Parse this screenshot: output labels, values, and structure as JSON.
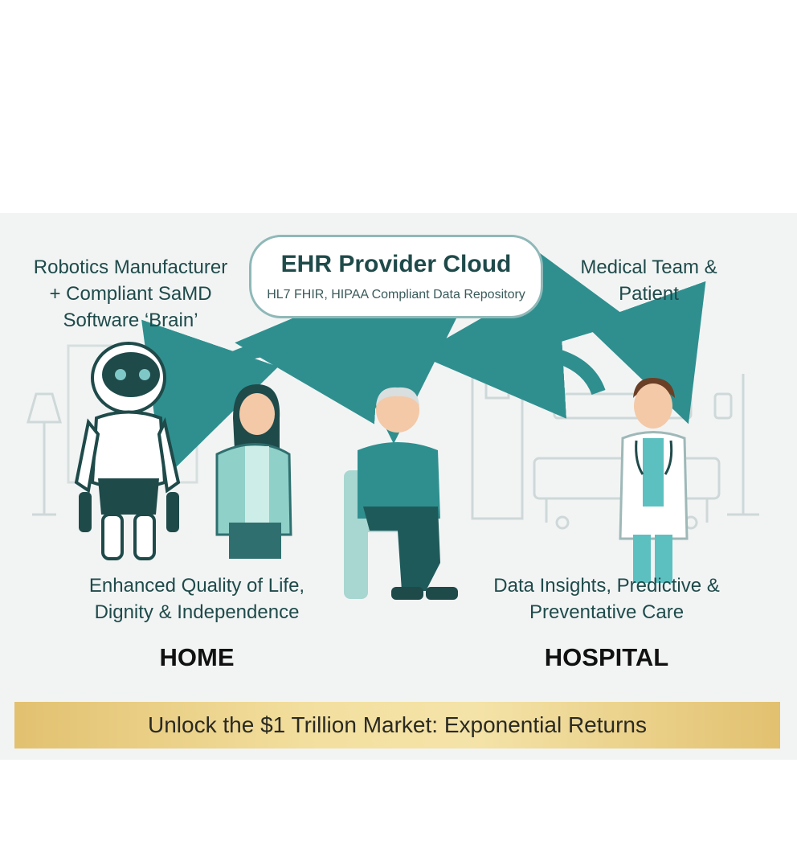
{
  "home_side": {
    "title_lines": [
      "Robotics Manufacturer",
      "+ Compliant SaMD",
      "Software ‘Brain’"
    ],
    "caption_lines": [
      "Enhanced Quality of Life,",
      "Dignity & Independence"
    ],
    "label": "HOME"
  },
  "cloud": {
    "title": "EHR Provider Cloud",
    "subtitle": "HL7 FHIR, HIPAA Compliant Data Repository"
  },
  "hospital_side": {
    "title_lines": [
      "Medical Team &",
      "Patient"
    ],
    "caption_lines": [
      "Data Insights, Predictive &",
      "Preventative Care"
    ],
    "label": "HOSPITAL"
  },
  "banner": {
    "text": "Unlock the $1 Trillion Market: Exponential Returns"
  },
  "colors": {
    "teal": "#2f8f8f",
    "dark_teal": "#1f4a4a",
    "gold": "#e8c878"
  },
  "icons": [
    "robot-icon",
    "caregiver-icon",
    "elderly-patient-icon",
    "doctor-icon",
    "hospital-bed-icon",
    "iv-stand-icon",
    "floor-lamp-icon"
  ]
}
